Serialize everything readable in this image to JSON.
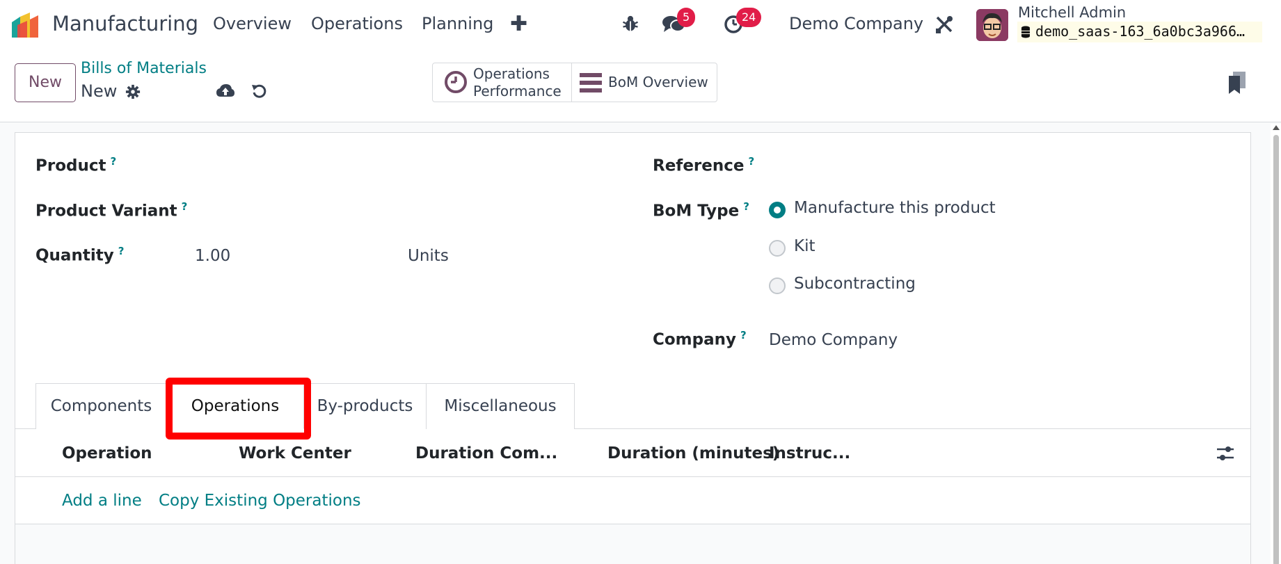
{
  "navbar": {
    "app_name": "Manufacturing",
    "menu": [
      "Overview",
      "Operations",
      "Planning"
    ],
    "messages_count": "5",
    "activities_count": "24",
    "company": "Demo Company",
    "user_name": "Mitchell Admin",
    "database": "demo_saas-163_6a0bc3a966…",
    "icons": [
      "app-logo-icon",
      "add-icon",
      "bug-icon",
      "chat-icon",
      "clock-icon",
      "tools-icon",
      "database-icon"
    ]
  },
  "control": {
    "new_button": "New",
    "breadcrumb_parent": "Bills of Materials",
    "breadcrumb_current": "New",
    "smart_buttons": [
      {
        "line1": "Operations",
        "line2": "Performance",
        "icon": "clock-icon"
      },
      {
        "label": "BoM Overview",
        "icon": "list-icon"
      }
    ]
  },
  "form": {
    "product_label": "Product",
    "variant_label": "Product Variant",
    "quantity_label": "Quantity",
    "quantity_value": "1.00",
    "uom_value": "Units",
    "reference_label": "Reference",
    "bom_type_label": "BoM Type",
    "bom_type_options": [
      "Manufacture this product",
      "Kit",
      "Subcontracting"
    ],
    "bom_type_selected": "Manufacture this product",
    "company_label": "Company",
    "company_value": "Demo Company",
    "help_mark": "?"
  },
  "tabs": [
    "Components",
    "Operations",
    "By-products",
    "Miscellaneous"
  ],
  "active_tab": "Operations",
  "operations_table": {
    "columns": [
      "Operation",
      "Work Center",
      "Duration Com...",
      "Duration (minutes)",
      "Instruc..."
    ],
    "actions": [
      "Add a line",
      "Copy Existing Operations"
    ]
  },
  "colors": {
    "primary": "#714b67",
    "link": "#017e84",
    "badge": "#e11d48",
    "highlight": "#ff0000"
  }
}
